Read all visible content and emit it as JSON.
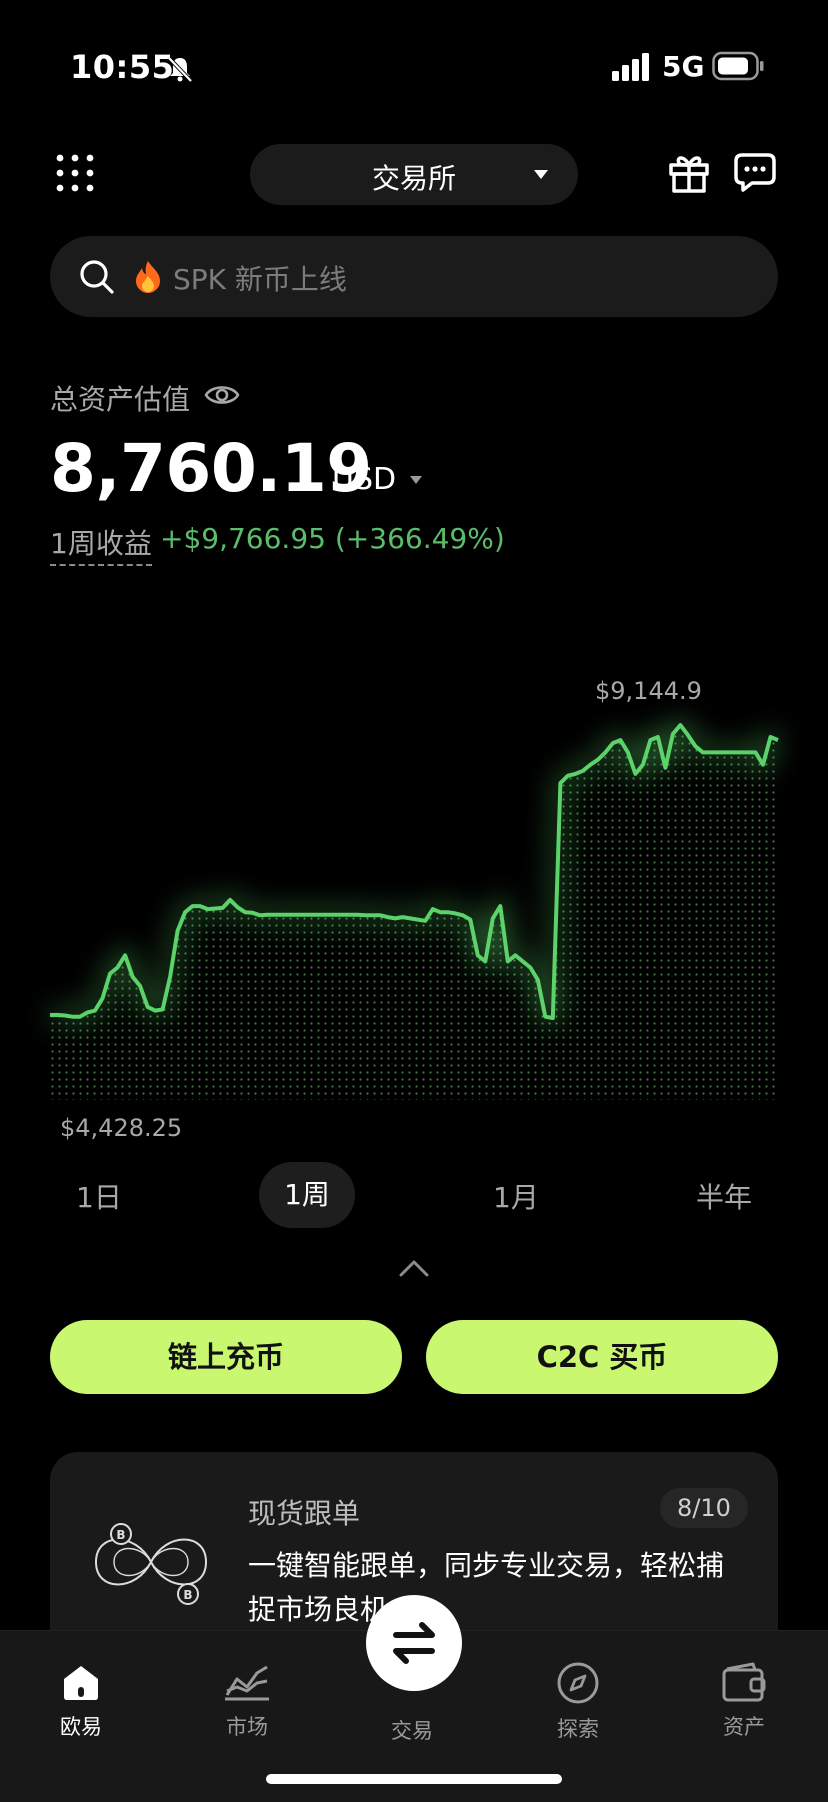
{
  "status_bar": {
    "time": "10:55",
    "network": "5G",
    "silent": true
  },
  "header": {
    "exchange_label": "交易所"
  },
  "search": {
    "placeholder": "SPK 新币上线"
  },
  "assets": {
    "label": "总资产估值",
    "balance": "8,760.19",
    "currency": "USD",
    "pnl_label": "1周收益",
    "pnl_value": "+$9,766.95 (+366.49%)"
  },
  "chart": {
    "max_label": "$9,144.9",
    "min_label": "$4,428.25",
    "line_color": "#5bd36a",
    "ranges": [
      "1日",
      "1周",
      "1月",
      "半年"
    ],
    "active_range": "1周"
  },
  "chart_data": {
    "type": "line",
    "title": "",
    "ylim": [
      4428.25,
      9144.9
    ],
    "values": [
      4428,
      4430,
      4420,
      4400,
      4400,
      4470,
      4500,
      4700,
      5100,
      5200,
      5400,
      5050,
      4900,
      4560,
      4500,
      4520,
      5050,
      5800,
      6100,
      6200,
      6200,
      6150,
      6160,
      6170,
      6300,
      6180,
      6100,
      6090,
      6050,
      6060,
      6060,
      6060,
      6060,
      6060,
      6060,
      6060,
      6060,
      6060,
      6060,
      6060,
      6060,
      6060,
      6050,
      6050,
      6050,
      6020,
      6000,
      6020,
      6000,
      5980,
      5960,
      6150,
      6100,
      6100,
      6080,
      6050,
      5980,
      5400,
      5300,
      6000,
      6200,
      5300,
      5400,
      5300,
      5200,
      5000,
      4400,
      4380,
      8200,
      8320,
      8350,
      8400,
      8500,
      8580,
      8700,
      8850,
      8900,
      8700,
      8350,
      8500,
      8900,
      8950,
      8450,
      9000,
      9144,
      8980,
      8800,
      8700,
      8700,
      8700,
      8700,
      8700,
      8700,
      8700,
      8700,
      8500,
      8950,
      8900
    ]
  },
  "actions": {
    "deposit": "链上充币",
    "c2c": "C2C 买币"
  },
  "promo_card": {
    "title": "现货跟单",
    "badge": "8/10",
    "body": "一键智能跟单，同步专业交易，轻松捕捉市场良机"
  },
  "bottom_nav": {
    "items": [
      {
        "label": "欧易",
        "icon": "home-icon",
        "active": true
      },
      {
        "label": "市场",
        "icon": "market-chart-icon",
        "active": false
      },
      {
        "label": "交易",
        "icon": "swap-icon",
        "active": false
      },
      {
        "label": "探索",
        "icon": "compass-icon",
        "active": false
      },
      {
        "label": "资产",
        "icon": "wallet-icon",
        "active": false
      }
    ]
  }
}
